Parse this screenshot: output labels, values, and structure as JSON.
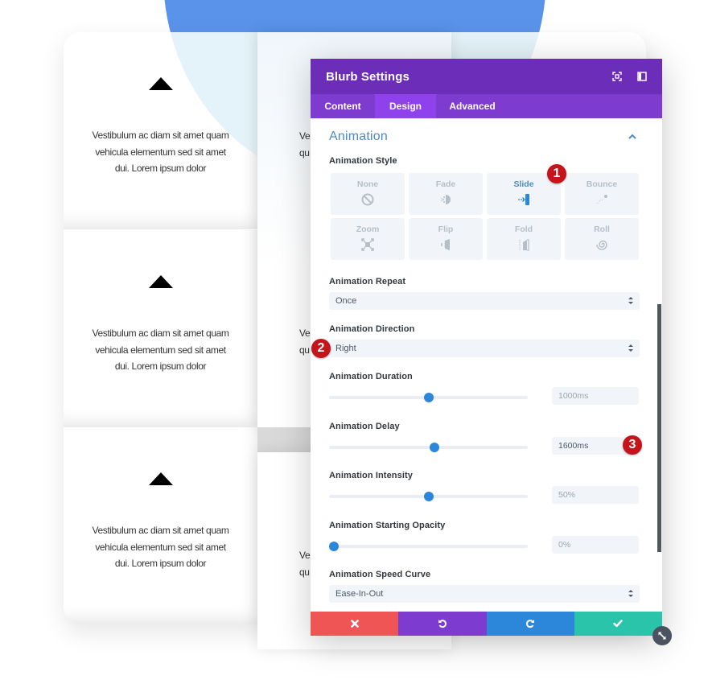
{
  "background": {
    "blurb_cards": [
      {
        "icon": "triangle-up-icon",
        "text": "Vestibulum ac diam sit amet quam vehicula elementum sed sit amet dui. Lorem ipsum dolor"
      },
      {
        "icon": "triangle-up-icon",
        "text": "Vestibulum ac diam sit amet quam vehicula elementum sed sit amet dui. Lorem ipsum dolor"
      },
      {
        "icon": "triangle-up-icon",
        "text": "Vestibulum ac diam sit amet quam vehicula elementum sed sit amet dui. Lorem ipsum dolor"
      }
    ],
    "partial_text": {
      "line1": "Ve",
      "line2": "qu"
    }
  },
  "modal": {
    "title": "Blurb Settings",
    "header_icons": [
      "expand-icon",
      "sidebar-toggle-icon"
    ],
    "tabs": [
      {
        "label": "Content",
        "active": false
      },
      {
        "label": "Design",
        "active": true
      },
      {
        "label": "Advanced",
        "active": false
      }
    ],
    "section": {
      "title": "Animation",
      "expanded": true
    },
    "animation_style": {
      "label": "Animation Style",
      "options": [
        {
          "label": "None",
          "icon": "none-icon",
          "active": false
        },
        {
          "label": "Fade",
          "icon": "fade-icon",
          "active": false
        },
        {
          "label": "Slide",
          "icon": "slide-icon",
          "active": true
        },
        {
          "label": "Bounce",
          "icon": "bounce-icon",
          "active": false
        },
        {
          "label": "Zoom",
          "icon": "zoom-icon",
          "active": false
        },
        {
          "label": "Flip",
          "icon": "flip-icon",
          "active": false
        },
        {
          "label": "Fold",
          "icon": "fold-icon",
          "active": false
        },
        {
          "label": "Roll",
          "icon": "roll-icon",
          "active": false
        }
      ]
    },
    "animation_repeat": {
      "label": "Animation Repeat",
      "value": "Once"
    },
    "animation_direction": {
      "label": "Animation Direction",
      "value": "Right"
    },
    "animation_duration": {
      "label": "Animation Duration",
      "value": "1000ms",
      "slider_fraction": 0.5
    },
    "animation_delay": {
      "label": "Animation Delay",
      "value": "1600ms",
      "slider_fraction": 0.53
    },
    "animation_intensity": {
      "label": "Animation Intensity",
      "value": "50%",
      "slider_fraction": 0.5
    },
    "animation_starting_opacity": {
      "label": "Animation Starting Opacity",
      "value": "0%",
      "slider_fraction": 0.0
    },
    "animation_speed_curve": {
      "label": "Animation Speed Curve",
      "value": "Ease-In-Out"
    },
    "footer": {
      "buttons": [
        "cancel",
        "undo",
        "redo",
        "save"
      ]
    }
  },
  "annotations": [
    "1",
    "2",
    "3"
  ],
  "colors": {
    "header": "#6c2eb9",
    "tabs": "#7e3bd0",
    "active_tab": "#8f42ec",
    "accent_blue": "#2b87da",
    "section_title": "#4c8bc8",
    "cancel": "#ef5555",
    "undo": "#7d3bd0",
    "redo": "#2c86da",
    "save": "#29c4a9",
    "badge": "#c5141c"
  }
}
